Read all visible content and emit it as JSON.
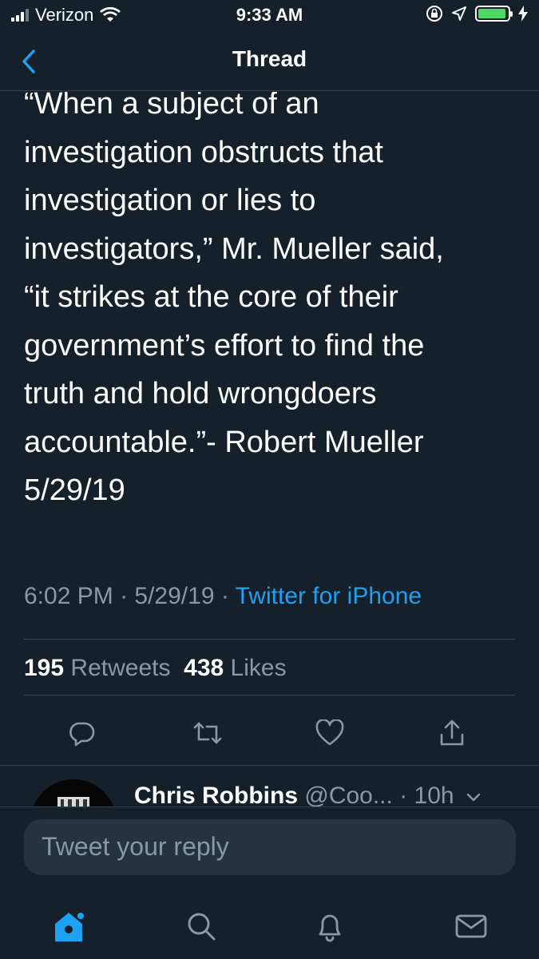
{
  "status_bar": {
    "carrier": "Verizon",
    "time": "9:33 AM"
  },
  "nav": {
    "title": "Thread"
  },
  "tweet": {
    "text": "“When a subject of an\ninvestigation obstructs that\ninvestigation or lies to\ninvestigators,” Mr. Mueller said,\n“it strikes at the core of their\ngovernment’s effort to find the\ntruth and hold wrongdoers\naccountable.”- Robert Mueller\n5/29/19",
    "time": "6:02 PM",
    "date": "5/29/19",
    "separator": " · ",
    "source": "Twitter for iPhone",
    "retweets_count": "195",
    "retweets_label": "Retweets",
    "likes_count": "438",
    "likes_label": "Likes"
  },
  "reply": {
    "name": "Chris Robbins",
    "handle": "@Coo...",
    "time": "· 10h"
  },
  "composer": {
    "placeholder": "Tweet your reply"
  },
  "colors": {
    "background": "#15202b",
    "accent": "#1da1f2",
    "muted": "#8899a6",
    "divider": "#38444d"
  },
  "icons": [
    "back-chevron-icon",
    "reply-icon",
    "retweet-icon",
    "like-icon",
    "share-icon",
    "home-icon",
    "search-icon",
    "notifications-icon",
    "messages-icon"
  ]
}
